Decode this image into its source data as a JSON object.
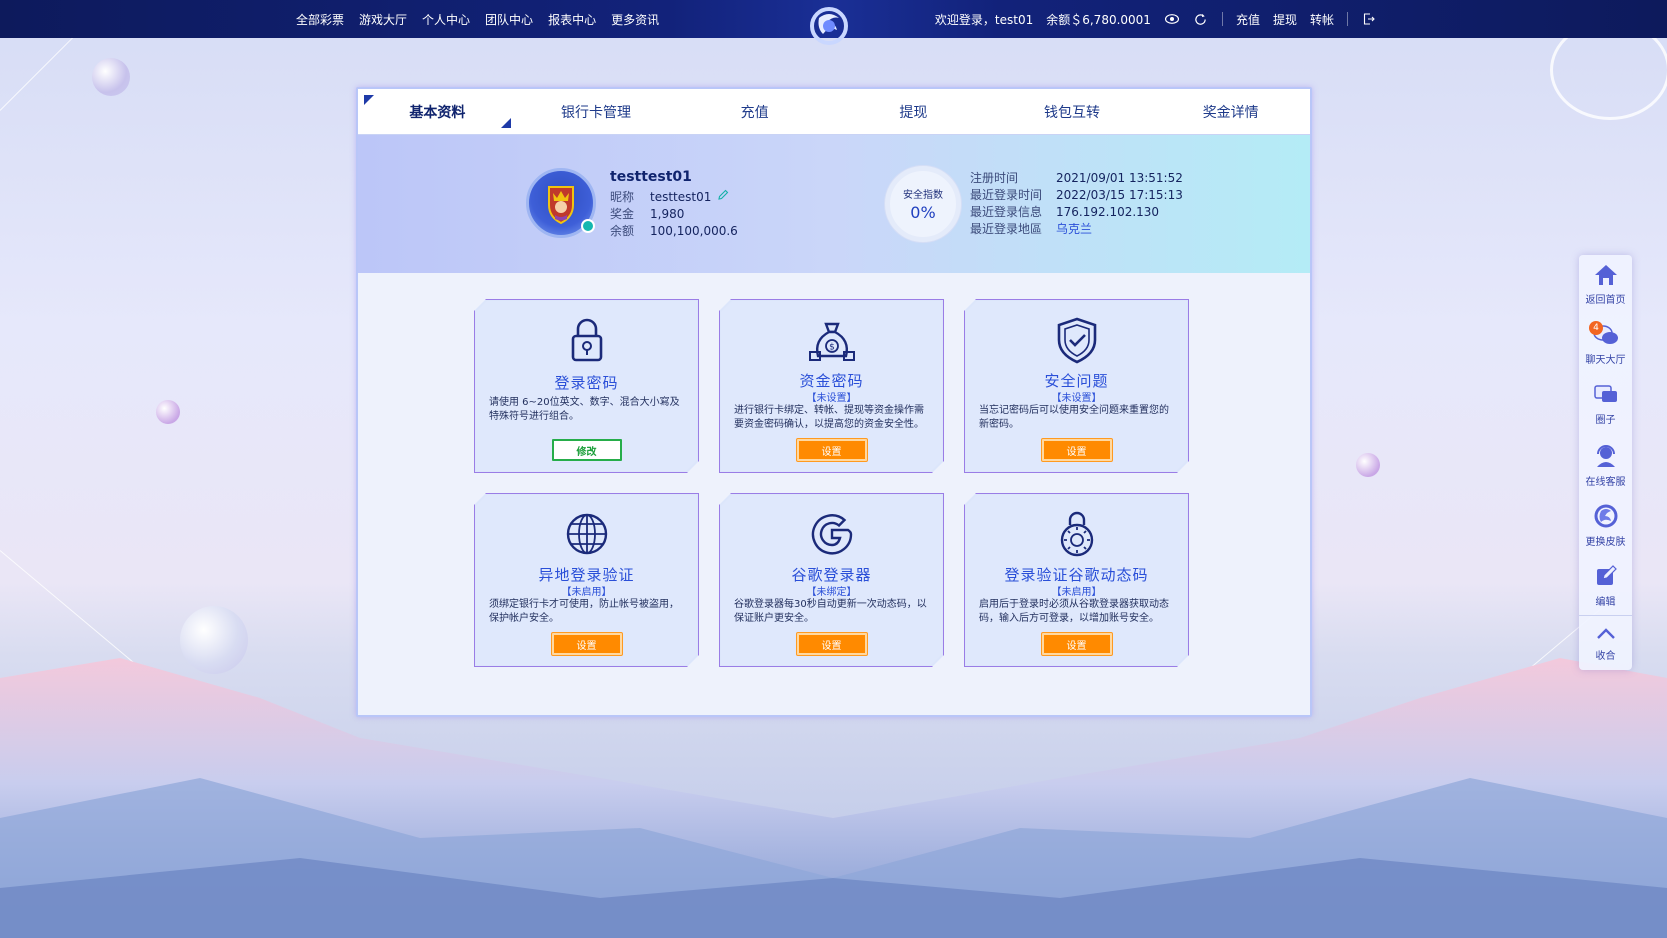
{
  "nav": {
    "left": [
      "全部彩票",
      "游戏大厅",
      "个人中心",
      "团队中心",
      "报表中心",
      "更多资讯"
    ],
    "welcome": "欢迎登录，test01",
    "balance": "余额＄6,780.0001",
    "recharge": "充值",
    "withdraw": "提现",
    "transfer": "转帐",
    "icons": [
      "eye-icon",
      "refresh-icon",
      "logout-icon"
    ]
  },
  "tabs": [
    "基本资料",
    "银行卡管理",
    "充值",
    "提现",
    "钱包互转",
    "奖金详情"
  ],
  "profile": {
    "username": "testtest01",
    "nickname_label": "昵称",
    "nickname": "testtest01",
    "bonus_label": "奖金",
    "bonus": "1,980",
    "balance_label": "余额",
    "balance": "100,100,000.6"
  },
  "safety": {
    "label": "安全指数",
    "value": "0%"
  },
  "login_info": {
    "reg_time_label": "注册时间",
    "reg_time": "2021/09/01 13:51:52",
    "last_login_label": "最近登录时间",
    "last_login": "2022/03/15 17:15:13",
    "last_ip_label": "最近登录信息",
    "last_ip": "176.192.102.130",
    "last_region_label": "最近登录地區",
    "last_region": "乌克兰"
  },
  "cards": [
    {
      "icon": "lock-icon",
      "title": "登录密码",
      "status": "",
      "desc": "请使用 6~20位英文、数字、混合大小寫及特殊符号进行组合。",
      "button": "修改"
    },
    {
      "icon": "money-bag-icon",
      "title": "资金密码",
      "status": "【未设置】",
      "desc": "进行银行卡绑定、转帐、提现等资金操作需要资金密码确认，以提高您的资金安全性。",
      "button": "设置"
    },
    {
      "icon": "shield-check-icon",
      "title": "安全问题",
      "status": "【未设置】",
      "desc": "当忘记密码后可以使用安全问题来重置您的新密码。",
      "button": "设置"
    },
    {
      "icon": "globe-icon",
      "title": "异地登录验证",
      "status": "【未启用】",
      "desc": "须绑定银行卡才可使用，防止帐号被盗用，保护帐户安全。",
      "button": "设置"
    },
    {
      "icon": "google-icon",
      "title": "谷歌登录器",
      "status": "【未绑定】",
      "desc": "谷歌登录器每30秒自动更新一次动态码，以保证账户更安全。",
      "button": "设置"
    },
    {
      "icon": "combination-lock-icon",
      "title": "登录验证谷歌动态码",
      "status": "【未启用】",
      "desc": "启用后于登录时必须从谷歌登录器获取动态码，输入后方可登录，以增加账号安全。",
      "button": "设置"
    }
  ],
  "sidebar": {
    "home": "返回首页",
    "chat": "聊天大厅",
    "chat_badge": "4",
    "circle": "圈子",
    "service": "在线客服",
    "skin": "更换皮肤",
    "edit": "编辑",
    "collapse": "收合"
  },
  "colors": {
    "accent": "#2a4fd8",
    "orange": "#ff8a00",
    "green": "#26ad4a",
    "nav": "#0d1a5c"
  }
}
